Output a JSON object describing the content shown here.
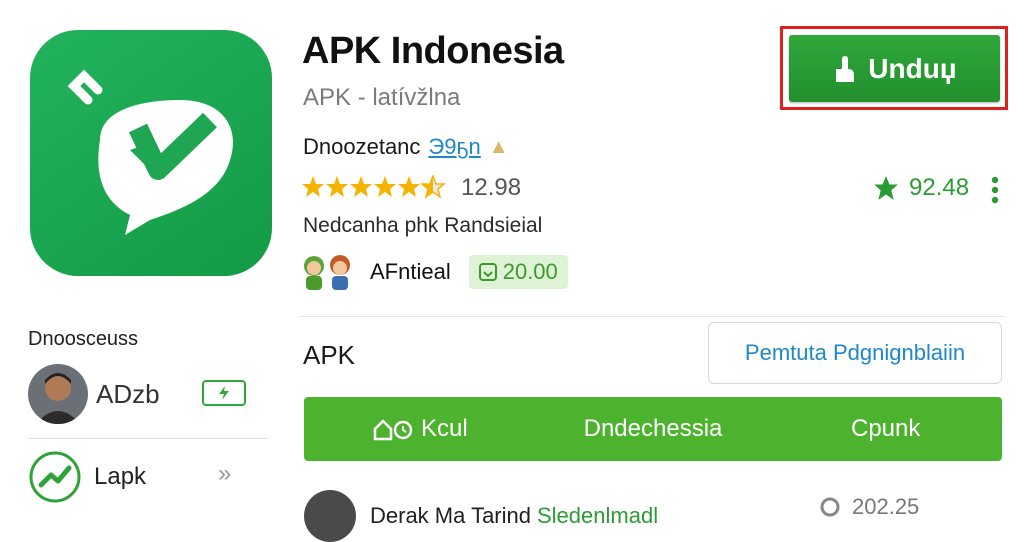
{
  "app": {
    "title": "APK Indonesia",
    "subtitle": "APK - latívžlna",
    "developer_prefix": "Dnoozetanc",
    "developer_link": "Э9ҕn",
    "rating_value": "12.98",
    "stars": 4.5,
    "description": "Nedcanha phk Randsieial",
    "meta_label": "AFntieal",
    "price": "20.00"
  },
  "actions": {
    "download_label": "Unduџ",
    "score": "92.48"
  },
  "sidebar": {
    "heading": "Dnoosceuss",
    "user_name": "ADzb",
    "lapk_label": "Lapk",
    "chevron": "»"
  },
  "main": {
    "section_title": "APK",
    "info_box": "Pemtuta Pdgnignblaiin",
    "tabs": [
      {
        "label": "Kcul"
      },
      {
        "label": "Dndechessia"
      },
      {
        "label": "Cpunk"
      }
    ],
    "bottom_item": {
      "text": "Derak Ma Tarind",
      "green_text": "Sledenlmadl",
      "right_value": "202.25"
    }
  },
  "colors": {
    "brand_green": "#1fa653",
    "button_green": "#2a9c35",
    "tab_green": "#4db32e",
    "highlight_red": "#e0201c",
    "link_blue": "#1e88c8"
  },
  "icons": [
    "app-logo-icon",
    "download-icon",
    "star-icon",
    "more-vert-icon",
    "lightning-badge-icon",
    "trend-icon",
    "chevron-right-icon"
  ]
}
